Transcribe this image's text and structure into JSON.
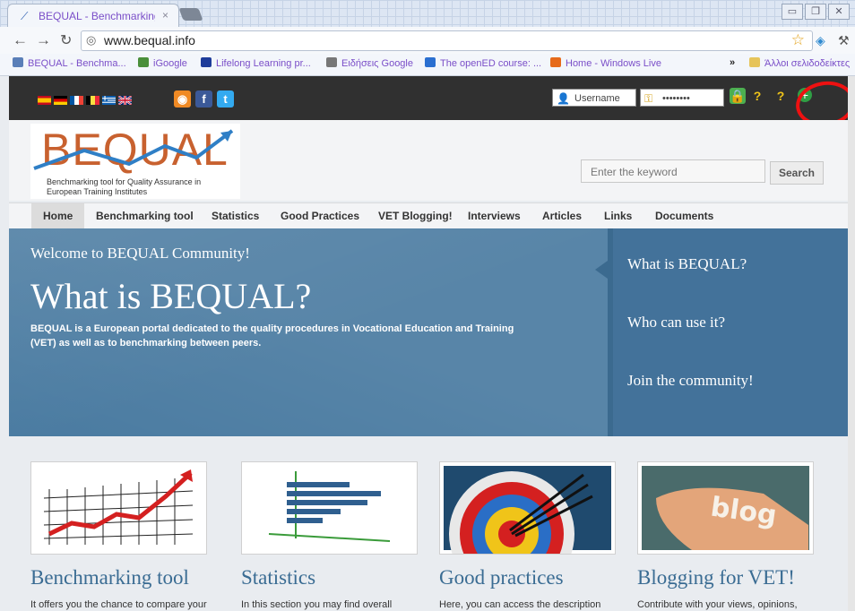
{
  "browser": {
    "tab": {
      "title": "BEQUAL - Benchmarking t...",
      "close": "×"
    },
    "url": "www.bequal.info",
    "bookmarks": [
      {
        "label": "BEQUAL - Benchma...",
        "color": "#5a7fb8"
      },
      {
        "label": "iGoogle",
        "color": "#4a8f3a"
      },
      {
        "label": "Lifelong Learning pr...",
        "color": "#1e3c9a"
      },
      {
        "label": "Ειδήσεις Google",
        "color": "#777777"
      },
      {
        "label": "The openED course: ...",
        "color": "#2a6fd0"
      },
      {
        "label": "Home - Windows Live",
        "color": "#e66a1a"
      }
    ],
    "more_bookmarks": "»",
    "other_bookmarks": "Άλλοι σελιδοδείκτες"
  },
  "topbar": {
    "flags": [
      "es",
      "de",
      "fr",
      "be",
      "gr",
      "uk"
    ],
    "username_placeholder": "Username",
    "password_mask": "••••••••"
  },
  "header": {
    "logo_word": "BEQUAL",
    "logo_tagline": "Benchmarking tool for Quality Assurance in European Training Institutes",
    "search_placeholder": "Enter the keyword",
    "search_button": "Search"
  },
  "menu": [
    "Home",
    "Benchmarking tool",
    "Statistics",
    "Good Practices",
    "VET Blogging!",
    "Interviews",
    "Articles",
    "Links",
    "Documents"
  ],
  "hero": {
    "welcome": "Welcome to BEQUAL Community!",
    "title": "What is BEQUAL?",
    "description": "BEQUAL is a European portal dedicated to the quality procedures in Vocational Education and Training (VET) as well as to benchmarking between peers.",
    "side_links": [
      "What is BEQUAL?",
      "Who can use it?",
      "Join the community!"
    ]
  },
  "cards": [
    {
      "title": "Benchmarking tool",
      "text": "It offers you the chance to compare your"
    },
    {
      "title": "Statistics",
      "text": "In this section you may find overall"
    },
    {
      "title": "Good practices",
      "text": "Here, you can access the description"
    },
    {
      "title": "Blogging for VET!",
      "text": "Contribute with your views, opinions,"
    }
  ],
  "blog_image_text": "blog"
}
